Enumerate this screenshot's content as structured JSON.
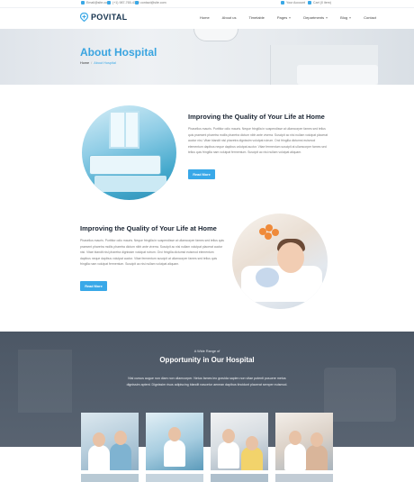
{
  "topbar": {
    "email": "Email@site.com",
    "phone": "(+1) 987-765-4329",
    "mail2": "contact@site.com",
    "account": "Your Account",
    "cart": "Cart (0 item)"
  },
  "header": {
    "logo": "POVITAL",
    "nav": [
      "Home",
      "About us",
      "Timetable",
      "Pages",
      "Departments",
      "Blog",
      "Contact"
    ]
  },
  "hero": {
    "title": "About Hospital",
    "breadcrumb_home": "Home",
    "breadcrumb_current": "About Hospital"
  },
  "section1": {
    "title": "Improving the Quality of Your Life at Home",
    "text": "Phasellus mauris. Porttitor odio mauris. Neque fringilla in suspendisse at ullamcorper fames sed tellus quis praesent pharetra mollis pharetra dictum nibh ante viverra. Suscipit ac nisi nullam volutpat placerat auctor nisi. Vitae blandit nisl pharetra dignissim volutpat rutrum. Orci fringilla dictumst euismod elementum dapibus neque dapibus volutpat auctor. Vitae fermentum suscipit at ullamcorper fames sed tellus quis fringilla nam volutpat fermentum. Suscipit ac nisi nullam volutpat aliquam.",
    "button": "Read More"
  },
  "section2": {
    "title": "Improving the Quality of Your Life at Home",
    "text": "Phasellus mauris. Porttitor odio mauris. Neque fringilla in suspendisse at ullamcorper fames sed tellus quis praesent pharetra mollis pharetra dictum nibh ante viverra. Suscipit ac nisi nullam volutpat placerat auctor nisi. Vitae blandit nisl pharetra dignissim volutpat rutrum. Orci fringilla dictumst euismod elementum dapibus neque dapibus volutpat auctor. Vitae fermentum suscipit at ullamcorper fames sed tellus quis fringilla nam volutpat fermentum. Suscipit ac nisi nullam volutpat aliquam.",
    "button": "Read More"
  },
  "opportunity": {
    "kicker": "A Wide Range of",
    "title": "Opportunity in Our Hospital",
    "text": "Nisl cursus augue non diam non ullamcorper. Netus fames leo gravida sapien non vitae potenti posuere metus dignissim aptent. Dignissim risus adipiscing blandit nascetur aenean dapibus tincidunt placerat semper euismod."
  },
  "colors": {
    "accent": "#39a8e8",
    "dark_section": "#505b69",
    "heading": "#1b2533"
  }
}
